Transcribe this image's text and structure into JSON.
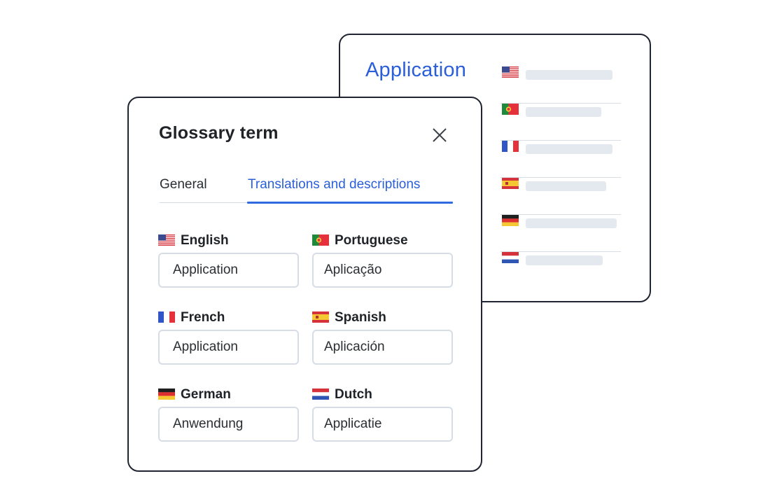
{
  "back_card": {
    "title": "Application",
    "rows": [
      {
        "flag_icon": "us-flag-icon",
        "bar_fraction": 0.78
      },
      {
        "flag_icon": "portugal-flag-icon",
        "bar_fraction": 0.69
      },
      {
        "flag_icon": "france-flag-icon",
        "bar_fraction": 0.78
      },
      {
        "flag_icon": "spain-flag-icon",
        "bar_fraction": 0.74
      },
      {
        "flag_icon": "germany-flag-icon",
        "bar_fraction": 0.83
      },
      {
        "flag_icon": "netherlands-flag-icon",
        "bar_fraction": 0.71
      }
    ]
  },
  "dialog": {
    "title": "Glossary term",
    "close_icon": "close-icon",
    "tabs": [
      {
        "label": "General",
        "active": false
      },
      {
        "label": "Translations and descriptions",
        "active": true
      }
    ],
    "fields": [
      {
        "language": "English",
        "flag_icon": "us-flag-icon",
        "value": "Application"
      },
      {
        "language": "Portuguese",
        "flag_icon": "portugal-flag-icon",
        "value": "Aplicação"
      },
      {
        "language": "French",
        "flag_icon": "france-flag-icon",
        "value": "Application"
      },
      {
        "language": "Spanish",
        "flag_icon": "spain-flag-icon",
        "value": "Aplicación"
      },
      {
        "language": "German",
        "flag_icon": "germany-flag-icon",
        "value": "Anwendung"
      },
      {
        "language": "Dutch",
        "flag_icon": "netherlands-flag-icon",
        "value": "Applicatie"
      }
    ]
  },
  "colors": {
    "accent": "#2b5fd9",
    "border_dark": "#1f2430",
    "input_border": "#d7dde6",
    "placeholder_bar": "#e4e9f0"
  }
}
